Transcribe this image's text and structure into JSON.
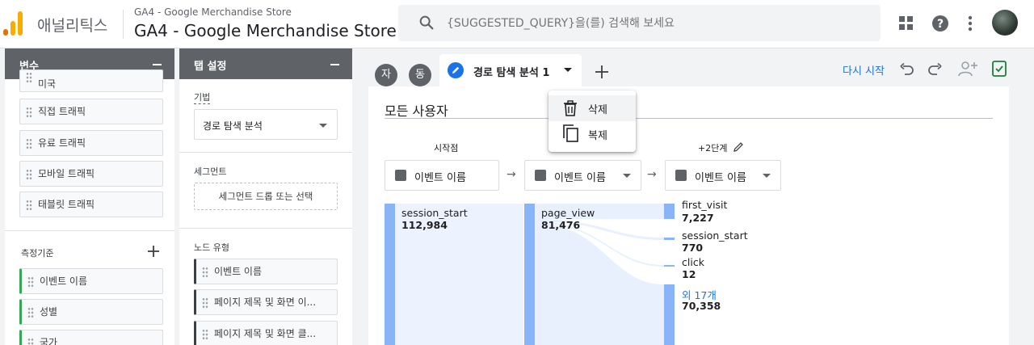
{
  "header": {
    "app_name": "애널리틱스",
    "property_small": "GA4 - Google Merchandise Store",
    "property_big": "GA4 - Google Merchandise Store",
    "search_placeholder": "{SUGGESTED_QUERY}을(를) 검색해 보세요",
    "icons": [
      "apps-grid-icon",
      "help-icon",
      "more-vert-icon"
    ],
    "brand_colors": {
      "orange": "#f9ab00",
      "dark_orange": "#e37400"
    }
  },
  "variables_panel": {
    "title": "변수",
    "segments": [
      "미국",
      "직접 트래픽",
      "유료 트래픽",
      "모바일 트래픽",
      "태블릿 트래픽"
    ],
    "dimensions_label": "측정기준",
    "dimensions": [
      "이벤트 이름",
      "성별",
      "국가"
    ]
  },
  "tab_settings": {
    "title": "탭 설정",
    "technique_label": "기법",
    "technique_value": "경로 탐색 분석",
    "segment_label": "세그먼트",
    "segment_drop": "세그먼트 드롭 또는 선택",
    "node_type_label": "노드 유형",
    "node_types": [
      "이벤트 이름",
      "페이지 제목 및 화면 이...",
      "페이지 제목 및 화면 클..."
    ]
  },
  "tabs": {
    "pill_1": "자",
    "pill_2": "동",
    "active_tab": "경로 탐색 분석 1",
    "restart": "다시 시작"
  },
  "context_menu": {
    "delete": "삭제",
    "duplicate": "복제"
  },
  "canvas": {
    "segment_title": "모든 사용자",
    "start_label": "시작점",
    "step2_label": "+2단계",
    "node_dropdown": "이벤트 이름",
    "columns": [
      {
        "nodes": [
          {
            "name": "session_start",
            "value": "112,984"
          }
        ]
      },
      {
        "nodes": [
          {
            "name": "page_view",
            "value": "81,476"
          }
        ]
      },
      {
        "nodes": [
          {
            "name": "first_visit",
            "value": "7,227"
          },
          {
            "name": "session_start",
            "value": "770"
          },
          {
            "name": "click",
            "value": "12"
          },
          {
            "name": "외 17개",
            "value": "70,358"
          }
        ]
      }
    ],
    "bar_color": "#8ab4f8",
    "link_color": "#1a73e8"
  }
}
